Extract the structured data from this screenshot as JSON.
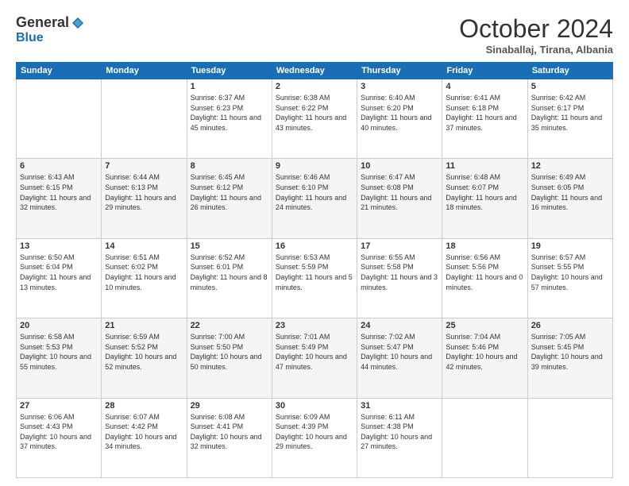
{
  "header": {
    "logo_general": "General",
    "logo_blue": "Blue",
    "month_title": "October 2024",
    "location": "Sinaballaj, Tirana, Albania"
  },
  "weekdays": [
    "Sunday",
    "Monday",
    "Tuesday",
    "Wednesday",
    "Thursday",
    "Friday",
    "Saturday"
  ],
  "weeks": [
    [
      {
        "day": "",
        "sunrise": "",
        "sunset": "",
        "daylight": ""
      },
      {
        "day": "",
        "sunrise": "",
        "sunset": "",
        "daylight": ""
      },
      {
        "day": "1",
        "sunrise": "Sunrise: 6:37 AM",
        "sunset": "Sunset: 6:23 PM",
        "daylight": "Daylight: 11 hours and 45 minutes."
      },
      {
        "day": "2",
        "sunrise": "Sunrise: 6:38 AM",
        "sunset": "Sunset: 6:22 PM",
        "daylight": "Daylight: 11 hours and 43 minutes."
      },
      {
        "day": "3",
        "sunrise": "Sunrise: 6:40 AM",
        "sunset": "Sunset: 6:20 PM",
        "daylight": "Daylight: 11 hours and 40 minutes."
      },
      {
        "day": "4",
        "sunrise": "Sunrise: 6:41 AM",
        "sunset": "Sunset: 6:18 PM",
        "daylight": "Daylight: 11 hours and 37 minutes."
      },
      {
        "day": "5",
        "sunrise": "Sunrise: 6:42 AM",
        "sunset": "Sunset: 6:17 PM",
        "daylight": "Daylight: 11 hours and 35 minutes."
      }
    ],
    [
      {
        "day": "6",
        "sunrise": "Sunrise: 6:43 AM",
        "sunset": "Sunset: 6:15 PM",
        "daylight": "Daylight: 11 hours and 32 minutes."
      },
      {
        "day": "7",
        "sunrise": "Sunrise: 6:44 AM",
        "sunset": "Sunset: 6:13 PM",
        "daylight": "Daylight: 11 hours and 29 minutes."
      },
      {
        "day": "8",
        "sunrise": "Sunrise: 6:45 AM",
        "sunset": "Sunset: 6:12 PM",
        "daylight": "Daylight: 11 hours and 26 minutes."
      },
      {
        "day": "9",
        "sunrise": "Sunrise: 6:46 AM",
        "sunset": "Sunset: 6:10 PM",
        "daylight": "Daylight: 11 hours and 24 minutes."
      },
      {
        "day": "10",
        "sunrise": "Sunrise: 6:47 AM",
        "sunset": "Sunset: 6:08 PM",
        "daylight": "Daylight: 11 hours and 21 minutes."
      },
      {
        "day": "11",
        "sunrise": "Sunrise: 6:48 AM",
        "sunset": "Sunset: 6:07 PM",
        "daylight": "Daylight: 11 hours and 18 minutes."
      },
      {
        "day": "12",
        "sunrise": "Sunrise: 6:49 AM",
        "sunset": "Sunset: 6:05 PM",
        "daylight": "Daylight: 11 hours and 16 minutes."
      }
    ],
    [
      {
        "day": "13",
        "sunrise": "Sunrise: 6:50 AM",
        "sunset": "Sunset: 6:04 PM",
        "daylight": "Daylight: 11 hours and 13 minutes."
      },
      {
        "day": "14",
        "sunrise": "Sunrise: 6:51 AM",
        "sunset": "Sunset: 6:02 PM",
        "daylight": "Daylight: 11 hours and 10 minutes."
      },
      {
        "day": "15",
        "sunrise": "Sunrise: 6:52 AM",
        "sunset": "Sunset: 6:01 PM",
        "daylight": "Daylight: 11 hours and 8 minutes."
      },
      {
        "day": "16",
        "sunrise": "Sunrise: 6:53 AM",
        "sunset": "Sunset: 5:59 PM",
        "daylight": "Daylight: 11 hours and 5 minutes."
      },
      {
        "day": "17",
        "sunrise": "Sunrise: 6:55 AM",
        "sunset": "Sunset: 5:58 PM",
        "daylight": "Daylight: 11 hours and 3 minutes."
      },
      {
        "day": "18",
        "sunrise": "Sunrise: 6:56 AM",
        "sunset": "Sunset: 5:56 PM",
        "daylight": "Daylight: 11 hours and 0 minutes."
      },
      {
        "day": "19",
        "sunrise": "Sunrise: 6:57 AM",
        "sunset": "Sunset: 5:55 PM",
        "daylight": "Daylight: 10 hours and 57 minutes."
      }
    ],
    [
      {
        "day": "20",
        "sunrise": "Sunrise: 6:58 AM",
        "sunset": "Sunset: 5:53 PM",
        "daylight": "Daylight: 10 hours and 55 minutes."
      },
      {
        "day": "21",
        "sunrise": "Sunrise: 6:59 AM",
        "sunset": "Sunset: 5:52 PM",
        "daylight": "Daylight: 10 hours and 52 minutes."
      },
      {
        "day": "22",
        "sunrise": "Sunrise: 7:00 AM",
        "sunset": "Sunset: 5:50 PM",
        "daylight": "Daylight: 10 hours and 50 minutes."
      },
      {
        "day": "23",
        "sunrise": "Sunrise: 7:01 AM",
        "sunset": "Sunset: 5:49 PM",
        "daylight": "Daylight: 10 hours and 47 minutes."
      },
      {
        "day": "24",
        "sunrise": "Sunrise: 7:02 AM",
        "sunset": "Sunset: 5:47 PM",
        "daylight": "Daylight: 10 hours and 44 minutes."
      },
      {
        "day": "25",
        "sunrise": "Sunrise: 7:04 AM",
        "sunset": "Sunset: 5:46 PM",
        "daylight": "Daylight: 10 hours and 42 minutes."
      },
      {
        "day": "26",
        "sunrise": "Sunrise: 7:05 AM",
        "sunset": "Sunset: 5:45 PM",
        "daylight": "Daylight: 10 hours and 39 minutes."
      }
    ],
    [
      {
        "day": "27",
        "sunrise": "Sunrise: 6:06 AM",
        "sunset": "Sunset: 4:43 PM",
        "daylight": "Daylight: 10 hours and 37 minutes."
      },
      {
        "day": "28",
        "sunrise": "Sunrise: 6:07 AM",
        "sunset": "Sunset: 4:42 PM",
        "daylight": "Daylight: 10 hours and 34 minutes."
      },
      {
        "day": "29",
        "sunrise": "Sunrise: 6:08 AM",
        "sunset": "Sunset: 4:41 PM",
        "daylight": "Daylight: 10 hours and 32 minutes."
      },
      {
        "day": "30",
        "sunrise": "Sunrise: 6:09 AM",
        "sunset": "Sunset: 4:39 PM",
        "daylight": "Daylight: 10 hours and 29 minutes."
      },
      {
        "day": "31",
        "sunrise": "Sunrise: 6:11 AM",
        "sunset": "Sunset: 4:38 PM",
        "daylight": "Daylight: 10 hours and 27 minutes."
      },
      {
        "day": "",
        "sunrise": "",
        "sunset": "",
        "daylight": ""
      },
      {
        "day": "",
        "sunrise": "",
        "sunset": "",
        "daylight": ""
      }
    ]
  ]
}
